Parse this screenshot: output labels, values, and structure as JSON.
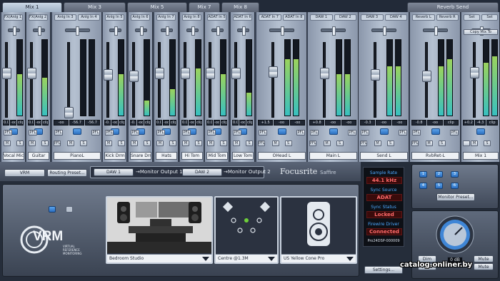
{
  "tabs": [
    "Mix 1",
    "Mix 3",
    "Mix 5",
    "Mix 7",
    "Mix 8",
    "Reverb Send"
  ],
  "strips": [
    {
      "labels": [
        "FX(Anlg 1)"
      ],
      "name": "Vocal Mic",
      "readouts": [
        "0.0",
        "-oo",
        "clip"
      ],
      "level": 0.62,
      "meters": [
        0.55
      ],
      "pfl": "PFL",
      "m": "M",
      "s": "S"
    },
    {
      "labels": [
        "FX(Anlg 2)"
      ],
      "name": "Guitar",
      "readouts": [
        "0.0",
        "-oo",
        "clip"
      ],
      "level": 0.62,
      "meters": [
        0.5
      ],
      "pfl": "PFL",
      "m": "M",
      "s": "S"
    },
    {
      "labels": [
        "Anlg In 3",
        "Anlg In 4"
      ],
      "name": "PianoL",
      "readouts": [
        "-oo",
        "-56.7",
        "-56.7"
      ],
      "level": 0.05,
      "meters": [
        0.0,
        0.0
      ],
      "pfl": "PFL",
      "m": "M",
      "s": "S"
    },
    {
      "labels": [
        "Anlg In 5"
      ],
      "name": "Kick Drm",
      "readouts": [
        "-0.3",
        "-oo",
        "clip"
      ],
      "level": 0.6,
      "meters": [
        0.55
      ],
      "pfl": "PFL",
      "m": "M",
      "s": "S"
    },
    {
      "labels": [
        "Anlg In 6"
      ],
      "name": "Snare Drm",
      "readouts": [
        "-0.6",
        "-oo",
        "clip"
      ],
      "level": 0.58,
      "meters": [
        0.2
      ],
      "pfl": "PFL",
      "m": "M",
      "s": "S"
    },
    {
      "labels": [
        "Anlg In 7"
      ],
      "name": "Hats",
      "readouts": [
        "0.0",
        "-oo",
        "clip"
      ],
      "level": 0.62,
      "meters": [
        0.35
      ],
      "pfl": "PFL",
      "m": "M",
      "s": "S"
    },
    {
      "labels": [
        "Anlg In 8"
      ],
      "name": "Hi Tom",
      "readouts": [
        "0.0",
        "-oo",
        "clip"
      ],
      "level": 0.62,
      "meters": [
        0.62
      ],
      "pfl": "PFL",
      "m": "M",
      "s": "S"
    },
    {
      "labels": [
        "ADAT In 5"
      ],
      "name": "Mid Tom",
      "readouts": [
        "0.0",
        "-oo",
        "clip"
      ],
      "level": 0.62,
      "meters": [
        0.55
      ],
      "pfl": "PFL",
      "m": "M",
      "s": "S"
    },
    {
      "labels": [
        "ADAT In 6"
      ],
      "name": "Low Tom",
      "readouts": [
        "0.0",
        "-oo",
        "clip"
      ],
      "level": 0.62,
      "meters": [
        0.3
      ],
      "pfl": "PFL",
      "m": "M",
      "s": "S"
    },
    {
      "labels": [
        "ADAT In 7",
        "ADAT In 8"
      ],
      "name": "OHead L",
      "readouts": [
        "+1.5",
        "-oo",
        "-oo"
      ],
      "level": 0.65,
      "meters": [
        0.75,
        0.75
      ],
      "pfl": "PFL",
      "m": "M",
      "s": "S"
    },
    {
      "labels": [
        "DAW 1",
        "DAW 2"
      ],
      "name": "Main L",
      "readouts": [
        "+0.8",
        "-oo",
        "-oo"
      ],
      "level": 0.63,
      "meters": [
        0.55,
        0.55
      ],
      "pfl": "PFL",
      "m": "M",
      "s": "S"
    },
    {
      "labels": [
        "DAW 3",
        "DAW 4"
      ],
      "name": "Send L",
      "readouts": [
        "-0.3",
        "-oo",
        "-oo"
      ],
      "level": 0.6,
      "meters": [
        0.65,
        0.65
      ],
      "pfl": "PFL",
      "m": "M",
      "s": "S"
    },
    {
      "labels": [
        "Reverb L",
        "Reverb R"
      ],
      "name": "RvbRet-L",
      "readouts": [
        "-0.8",
        "-oo",
        "clip"
      ],
      "level": 0.58,
      "meters": [
        0.65,
        0.75
      ],
      "pfl": "PFL",
      "m": "M",
      "s": "S"
    },
    {
      "labels": [
        "Set",
        "Set"
      ],
      "name": "Mix 1",
      "readouts": [
        "+0.2",
        "-4.3",
        "clip"
      ],
      "level": 0.64,
      "meters": [
        0.7,
        0.78
      ],
      "pfl": "",
      "m": "M",
      "s": "S",
      "extra": "Copy Mix To"
    }
  ],
  "bar": {
    "vrm": "VRM",
    "routing": "Routing Preset...",
    "daw1": "DAW 1",
    "daw2": "DAW 2",
    "route1": "→Monitor Output 1",
    "route2": "→Monitor Output 2",
    "brand": "Focusrite",
    "product": "Saffire"
  },
  "vrm": {
    "logo": "VRM",
    "subtitle": "VIRTUAL\nREFERENCE\nMONITORING",
    "room": "Bedroom Studio",
    "position": "Centre @1.3M",
    "speaker": "US Yellow Cone Pro"
  },
  "status": {
    "sample_rate_label": "Sample Rate",
    "sample_rate": "44.1 kHz",
    "sync_source_label": "Sync Source",
    "sync_source": "ADAT",
    "sync_status_label": "Sync Status",
    "sync_status": "Locked",
    "firewire_label": "Firewire Driver",
    "firewire": "Connected",
    "device_id": "Pro24DSP-000009",
    "settings": "Settings..."
  },
  "monitor": {
    "preset": "Monitor Preset...",
    "buttons": [
      "1",
      "2",
      "3",
      "4",
      "5",
      "6"
    ]
  },
  "output": {
    "db": "0 dB",
    "dim": "Dim",
    "mute": "Mute",
    "dim_mute": "Mute",
    "mute_all": "Mute"
  },
  "watermark": "catalog.onliner.by"
}
